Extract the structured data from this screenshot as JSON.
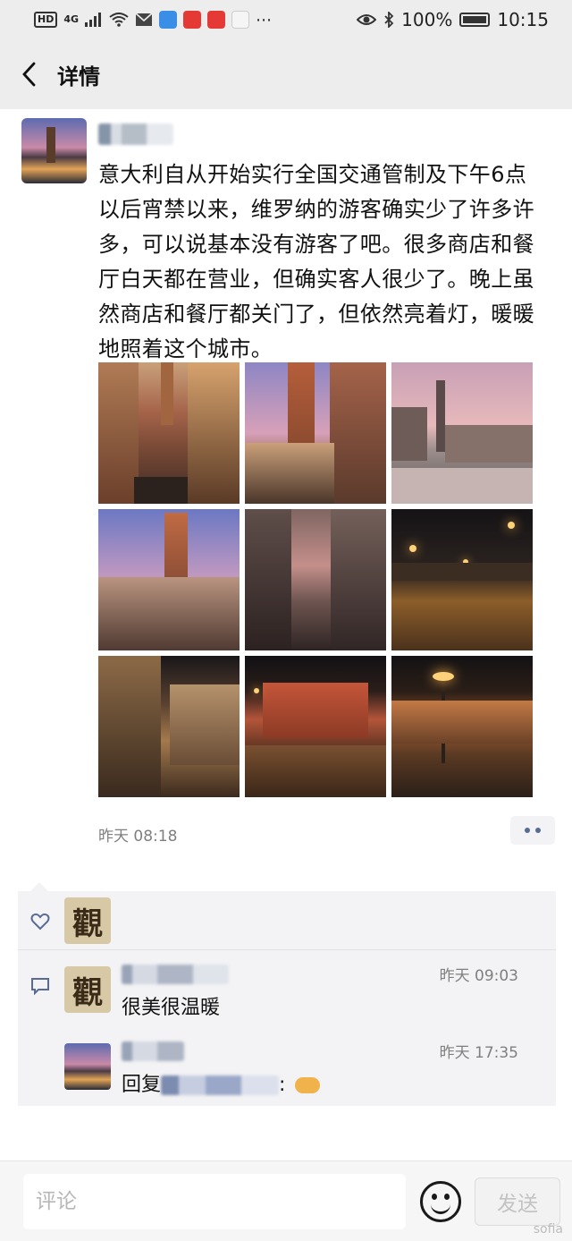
{
  "status_bar": {
    "network": "4G",
    "battery": "100%",
    "time": "10:15"
  },
  "nav": {
    "title": "详情"
  },
  "post": {
    "text": "意大利自从开始实行全国交通管制及下午6点以后宵禁以来，维罗纳的游客确实少了许多许多，可以说基本没有游客了吧。很多商店和餐厅白天都在营业，但确实客人很少了。晚上虽然商店和餐厅都关门了，但依然亮着灯，暖暖地照着这个城市。",
    "time": "昨天 08:18",
    "photos": [
      {
        "icon": "alley-dusk"
      },
      {
        "icon": "tower-pink-sky"
      },
      {
        "icon": "piazza-dusk"
      },
      {
        "icon": "tower-purple-sky"
      },
      {
        "icon": "narrow-street"
      },
      {
        "icon": "piazza-night"
      },
      {
        "icon": "arcade-night"
      },
      {
        "icon": "red-palace-night"
      },
      {
        "icon": "square-lamps-night"
      }
    ]
  },
  "interaction": {
    "like_avatar_glyph": "觀",
    "comments": [
      {
        "avatar_glyph": "觀",
        "time": "昨天 09:03",
        "text": "很美很温暖"
      },
      {
        "time": "昨天 17:35",
        "reply_prefix": "回复",
        "reply_suffix": ":"
      }
    ]
  },
  "input": {
    "placeholder": "评论",
    "send_label": "发送"
  },
  "watermark": "sofia",
  "colors": {
    "link": "#576b95",
    "bar_bg": "#ededed",
    "panel_bg": "#f3f3f5"
  }
}
